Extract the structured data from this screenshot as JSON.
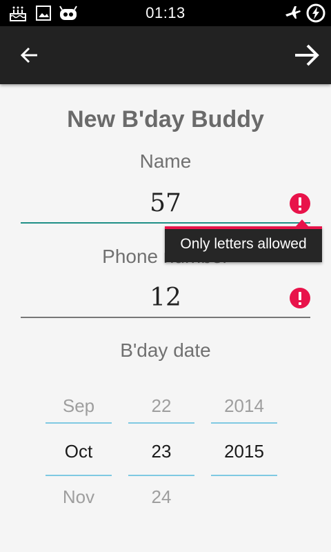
{
  "status_bar": {
    "time": "01:13",
    "left_icons": [
      "cake-icon",
      "image-icon",
      "android-icon"
    ],
    "right_icons": [
      "airplane-mode-icon",
      "battery-charging-icon"
    ]
  },
  "action_bar": {
    "back_icon": "arrow-left-icon",
    "next_icon": "arrow-right-icon"
  },
  "form": {
    "title": "New B'day Buddy",
    "name": {
      "label": "Name",
      "value": "57",
      "error_icon": "error-icon",
      "line_color": "#1e8f86"
    },
    "error_tooltip": {
      "text": "Only letters allowed",
      "accent_color": "#e8134a"
    },
    "phone": {
      "label": "Phone number",
      "value": "12",
      "error_icon": "error-icon"
    },
    "date": {
      "label": "B'day date",
      "month": {
        "prev": "Sep",
        "current": "Oct",
        "next": "Nov"
      },
      "day": {
        "prev": "22",
        "current": "23",
        "next": "24"
      },
      "year": {
        "prev": "2014",
        "current": "2015",
        "next": ""
      }
    }
  },
  "colors": {
    "error": "#e8134a",
    "picker_divider": "#7ec9e2"
  }
}
